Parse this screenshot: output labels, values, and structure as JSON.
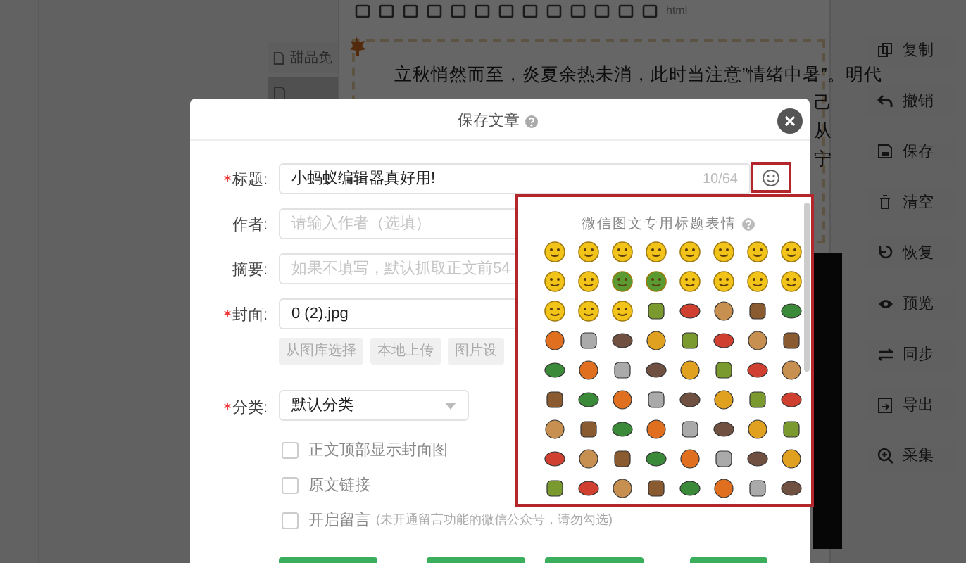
{
  "toolbar": {
    "html_label": "html"
  },
  "side_tabs": [
    {
      "label": "甜品免",
      "selected": false
    },
    {
      "selected": true
    }
  ],
  "article": {
    "lines": [
      "立秋悄然而至，炎夏余热未消，此时当注意”情绪中暑”。明代",
      "己",
      "从",
      "宁"
    ]
  },
  "actions": [
    {
      "label": "复制"
    },
    {
      "label": "撤销"
    },
    {
      "label": "保存"
    },
    {
      "label": "清空"
    },
    {
      "label": "恢复"
    },
    {
      "label": "预览"
    },
    {
      "label": "同步"
    },
    {
      "label": "导出"
    },
    {
      "label": "采集"
    }
  ],
  "dialog": {
    "title": "保存文章",
    "fields": [
      {
        "label": "标题:",
        "required": true,
        "value": "小蚂蚁编辑器真好用!",
        "counter": "10/64"
      },
      {
        "label": "作者:",
        "required": false,
        "placeholder": "请输入作者（选填）"
      },
      {
        "label": "摘要:",
        "required": false,
        "placeholder": "如果不填写，默认抓取正文前54"
      },
      {
        "label": "封面:",
        "required": true,
        "value": "0 (2).jpg"
      }
    ],
    "cover_buttons": [
      "从图库选择",
      "本地上传",
      "图片设"
    ],
    "category": {
      "label": "分类:",
      "required": true,
      "value": "默认分类"
    },
    "options": [
      {
        "label": "正文顶部显示封面图",
        "checked": false
      },
      {
        "label": "原文链接",
        "checked": false
      },
      {
        "label": "开启留言",
        "checked": false,
        "note": "(未开通留言功能的微信公众号，请勿勾选)"
      }
    ]
  },
  "emoji_panel": {
    "title": "微信图文专用标题表情"
  }
}
